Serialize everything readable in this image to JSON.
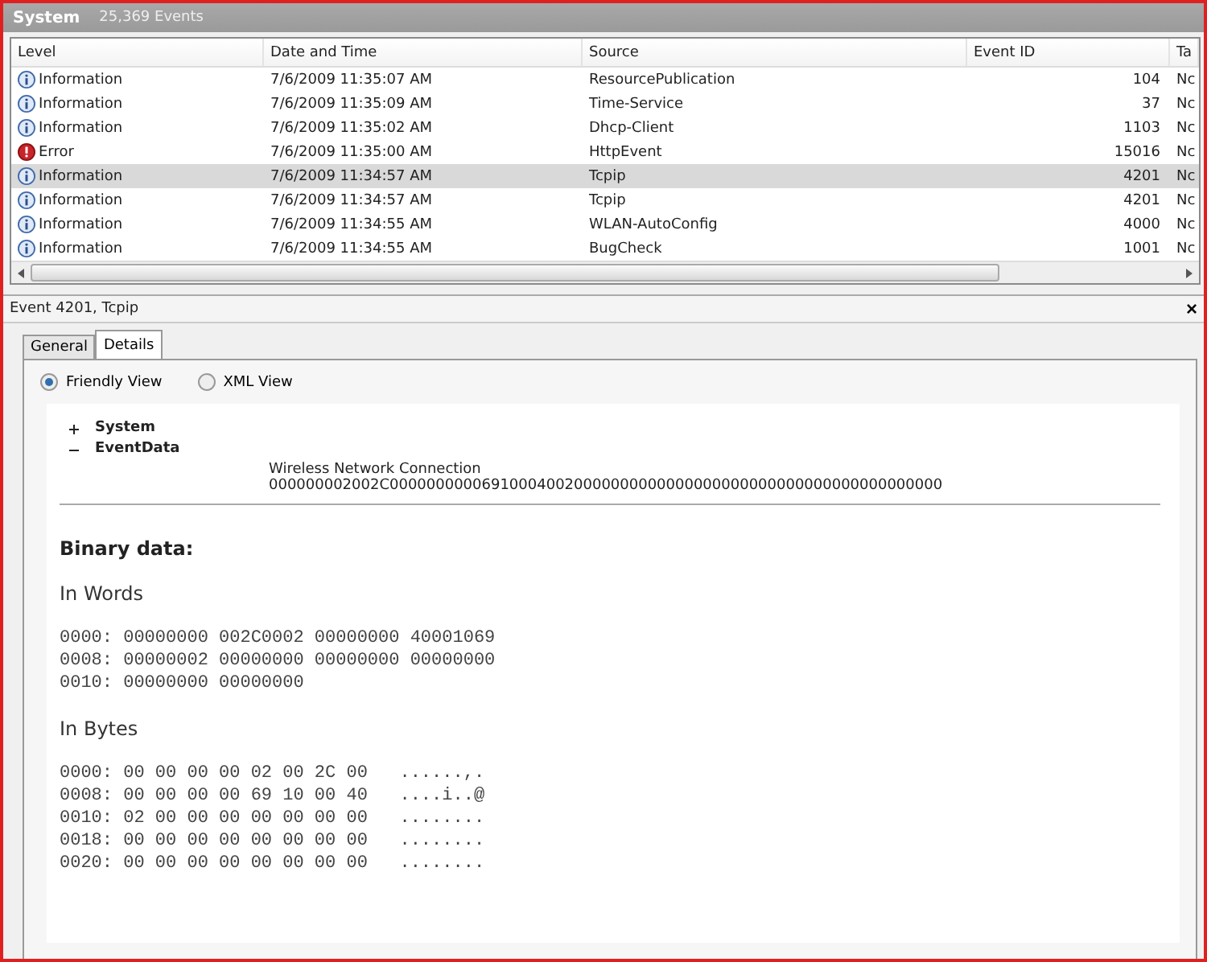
{
  "log_header": {
    "title": "System",
    "count": "25,369 Events"
  },
  "table": {
    "columns": [
      "Level",
      "Date and Time",
      "Source",
      "Event ID",
      "Ta"
    ],
    "rows": [
      {
        "kind": "information",
        "selected": false,
        "cells": [
          "Information",
          "7/6/2009 11:35:07 AM",
          "ResourcePublication",
          "104",
          "Nc"
        ]
      },
      {
        "kind": "information",
        "selected": false,
        "cells": [
          "Information",
          "7/6/2009 11:35:09 AM",
          "Time-Service",
          "37",
          "Nc"
        ]
      },
      {
        "kind": "information",
        "selected": false,
        "cells": [
          "Information",
          "7/6/2009 11:35:02 AM",
          "Dhcp-Client",
          "1103",
          "Nc"
        ]
      },
      {
        "kind": "error",
        "selected": false,
        "cells": [
          "Error",
          "7/6/2009 11:35:00 AM",
          "HttpEvent",
          "15016",
          "Nc"
        ]
      },
      {
        "kind": "information",
        "selected": true,
        "cells": [
          "Information",
          "7/6/2009 11:34:57 AM",
          "Tcpip",
          "4201",
          "Nc"
        ]
      },
      {
        "kind": "information",
        "selected": false,
        "cells": [
          "Information",
          "7/6/2009 11:34:57 AM",
          "Tcpip",
          "4201",
          "Nc"
        ]
      },
      {
        "kind": "information",
        "selected": false,
        "cells": [
          "Information",
          "7/6/2009 11:34:55 AM",
          "WLAN-AutoConfig",
          "4000",
          "Nc"
        ]
      },
      {
        "kind": "information",
        "selected": false,
        "cells": [
          "Information",
          "7/6/2009 11:34:55 AM",
          "BugCheck",
          "1001",
          "Nc"
        ]
      }
    ]
  },
  "details": {
    "title": "Event 4201, Tcpip",
    "close": "×",
    "tabs": [
      {
        "label": "General",
        "selected": false
      },
      {
        "label": "Details",
        "selected": true
      }
    ],
    "views": [
      {
        "label": "Friendly View",
        "selected": true
      },
      {
        "label": "XML View",
        "selected": false
      }
    ],
    "tree": [
      {
        "label": "System",
        "expanded": false
      },
      {
        "label": "EventData",
        "expanded": true,
        "values": [
          "Wireless Network Connection",
          "000000002002C000000000069100040020000000000000000000000000000000000000000"
        ]
      }
    ],
    "binary_title": "Binary data:",
    "sections": [
      {
        "title": "In Words",
        "lines": [
          "0000: 00000000 002C0002 00000000 40001069",
          "0008: 00000002 00000000 00000000 00000000",
          "0010: 00000000 00000000"
        ]
      },
      {
        "title": "In Bytes",
        "lines": [
          "0000: 00 00 00 00 02 00 2C 00   ......,.",
          "0008: 00 00 00 00 69 10 00 40   ....i..@",
          "0010: 02 00 00 00 00 00 00 00   ........",
          "0018: 00 00 00 00 00 00 00 00   ........",
          "0020: 00 00 00 00 00 00 00 00   ........"
        ]
      }
    ]
  }
}
